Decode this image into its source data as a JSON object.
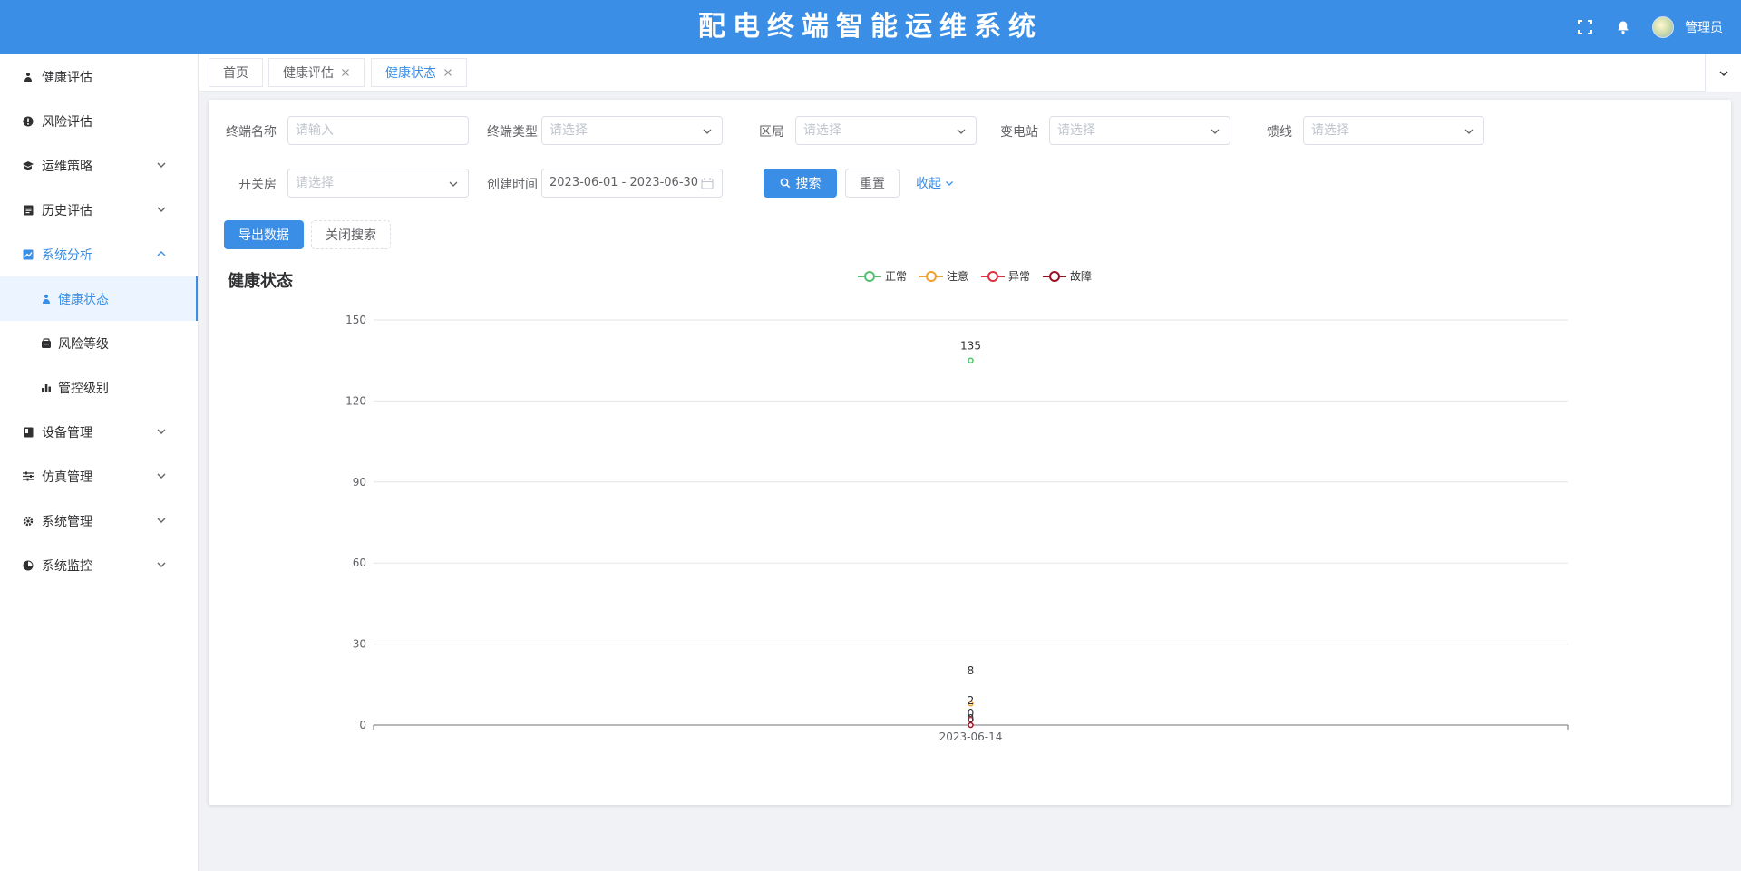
{
  "app": {
    "title": "配电终端智能运维系统",
    "user": "管理员"
  },
  "header_icons": [
    "fullscreen-icon",
    "bell-icon"
  ],
  "sidebar": {
    "items": [
      {
        "label": "健康评估",
        "icon": "health-icon",
        "expandable": false
      },
      {
        "label": "风险评估",
        "icon": "risk-icon",
        "expandable": false
      },
      {
        "label": "运维策略",
        "icon": "strategy-icon",
        "expandable": true
      },
      {
        "label": "历史评估",
        "icon": "history-icon",
        "expandable": true
      },
      {
        "label": "系统分析",
        "icon": "analysis-icon",
        "expandable": true,
        "open": true,
        "children": [
          {
            "label": "健康状态",
            "icon": "health-status-icon",
            "active": true
          },
          {
            "label": "风险等级",
            "icon": "risk-level-icon"
          },
          {
            "label": "管控级别",
            "icon": "control-level-icon"
          }
        ]
      },
      {
        "label": "设备管理",
        "icon": "device-icon",
        "expandable": true
      },
      {
        "label": "仿真管理",
        "icon": "simulation-icon",
        "expandable": true
      },
      {
        "label": "系统管理",
        "icon": "gear-icon",
        "expandable": true
      },
      {
        "label": "系统监控",
        "icon": "monitor-icon",
        "expandable": true
      }
    ]
  },
  "tabs": [
    {
      "label": "首页",
      "closable": false
    },
    {
      "label": "健康评估",
      "closable": true
    },
    {
      "label": "健康状态",
      "closable": true,
      "active": true
    }
  ],
  "filters": {
    "terminal_name": {
      "label": "终端名称",
      "placeholder": "请输入"
    },
    "terminal_type": {
      "label": "终端类型",
      "placeholder": "请选择"
    },
    "district": {
      "label": "区局",
      "placeholder": "请选择"
    },
    "substation": {
      "label": "变电站",
      "placeholder": "请选择"
    },
    "feeder": {
      "label": "馈线",
      "placeholder": "请选择"
    },
    "switch_room": {
      "label": "开关房",
      "placeholder": "请选择"
    },
    "created_time": {
      "label": "创建时间",
      "value": "2023-06-01 - 2023-06-30"
    }
  },
  "buttons": {
    "search": "搜索",
    "reset": "重置",
    "collapse": "收起",
    "export": "导出数据",
    "close_search": "关闭搜索"
  },
  "chart_title": "健康状态",
  "colors": {
    "primary": "#3a8ee6",
    "normal": "#52c26c",
    "attention": "#f0a030",
    "abnormal": "#e03040",
    "fault": "#9b1020"
  },
  "chart_data": {
    "type": "line",
    "x": [
      "2023-06-14"
    ],
    "series": [
      {
        "name": "正常",
        "values": [
          135
        ],
        "color": "#52c26c"
      },
      {
        "name": "注意",
        "values": [
          8
        ],
        "color": "#f0a030"
      },
      {
        "name": "异常",
        "values": [
          2
        ],
        "color": "#e03040"
      },
      {
        "name": "故障",
        "values": [
          0
        ],
        "color": "#9b1020"
      }
    ],
    "ylim": [
      0,
      150
    ],
    "yticks": [
      0,
      30,
      60,
      90,
      120,
      150
    ],
    "extra_labels": [
      "0"
    ],
    "grid": true,
    "legend": "top-center"
  }
}
